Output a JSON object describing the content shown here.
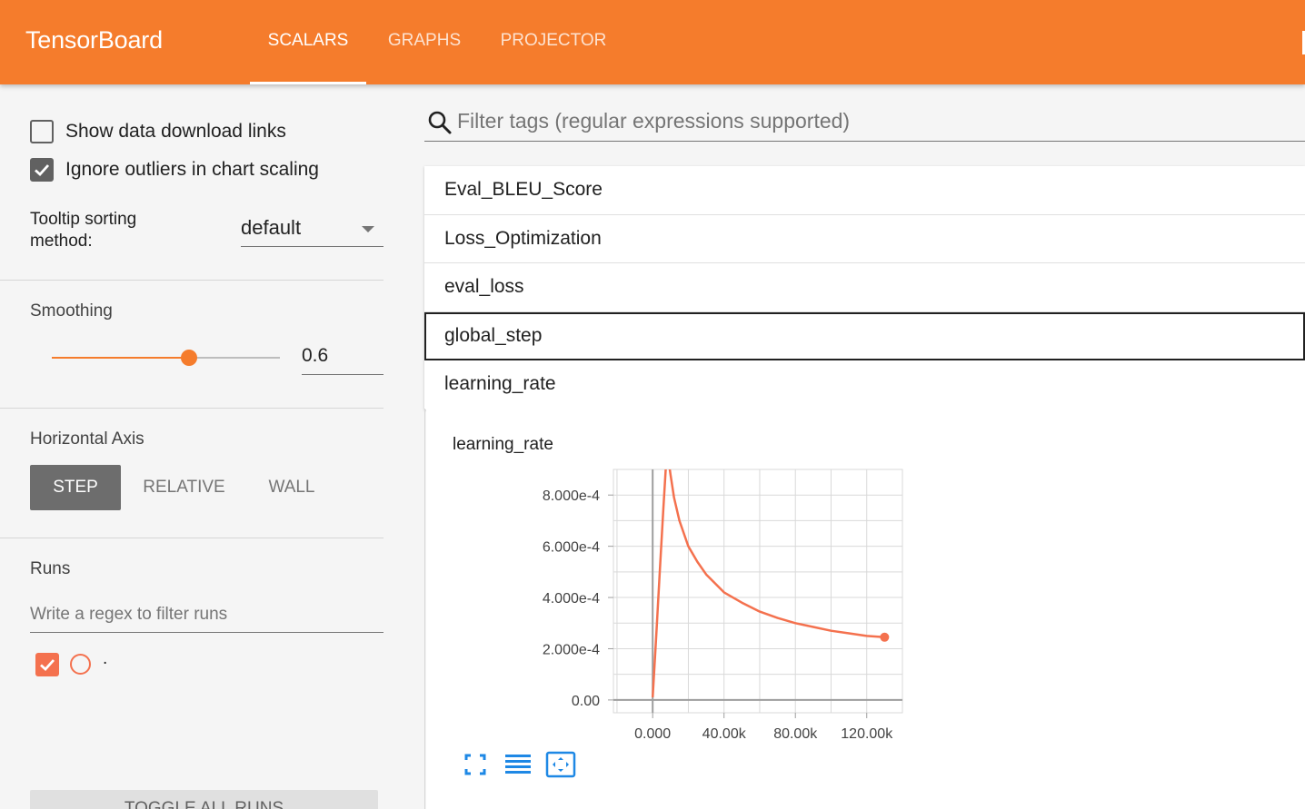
{
  "header": {
    "brand": "TensorBoard",
    "tabs": [
      {
        "label": "SCALARS",
        "active": true
      },
      {
        "label": "GRAPHS",
        "active": false
      },
      {
        "label": "PROJECTOR",
        "active": false
      }
    ],
    "background_color": "#f57c2c"
  },
  "sidebar": {
    "checkboxes": [
      {
        "label": "Show data download links",
        "checked": false
      },
      {
        "label": "Ignore outliers in chart scaling",
        "checked": true
      }
    ],
    "tooltip_sorting": {
      "label": "Tooltip sorting method:",
      "value": "default"
    },
    "smoothing": {
      "title": "Smoothing",
      "value": "0.6",
      "fraction": 0.6
    },
    "horizontal_axis": {
      "title": "Horizontal Axis",
      "options": [
        {
          "label": "STEP",
          "active": true
        },
        {
          "label": "RELATIVE",
          "active": false
        },
        {
          "label": "WALL",
          "active": false
        }
      ]
    },
    "runs": {
      "title": "Runs",
      "filter_placeholder": "Write a regex to filter runs",
      "items": [
        {
          "name": ".",
          "checked": true,
          "color": "#f4714e"
        }
      ],
      "toggle_all_label": "TOGGLE ALL RUNS"
    }
  },
  "main": {
    "search": {
      "placeholder": "Filter tags (regular expressions supported)",
      "icon": "search-icon"
    },
    "tags": [
      "Eval_BLEU_Score",
      "Loss_Optimization",
      "eval_loss",
      "global_step",
      "learning_rate"
    ],
    "focused_tag": "global_step",
    "chart_buttons": [
      "fit-to-screen-icon",
      "toggle-log-scale-icon",
      "reset-zoom-icon"
    ]
  },
  "chart_data": {
    "type": "line",
    "title": "learning_rate",
    "xlabel": "",
    "ylabel": "",
    "xlim": [
      -22000,
      140000
    ],
    "ylim": [
      -5e-05,
      0.0009
    ],
    "x_ticks": [
      0,
      40000,
      80000,
      120000
    ],
    "x_tick_labels": [
      "0.000",
      "40.00k",
      "80.00k",
      "120.00k"
    ],
    "y_ticks": [
      0,
      0.0002,
      0.0004,
      0.0006,
      0.0008
    ],
    "y_tick_labels": [
      "0.00",
      "2.000e-4",
      "4.000e-4",
      "6.000e-4",
      "8.000e-4"
    ],
    "grid": true,
    "series": [
      {
        "color": "#f4714e",
        "x": [
          0,
          2000,
          4000,
          6000,
          8000,
          10000,
          12000,
          15000,
          20000,
          25000,
          30000,
          40000,
          50000,
          60000,
          70000,
          80000,
          90000,
          100000,
          110000,
          120000,
          130000
        ],
        "y": [
          1e-05,
          0.00025,
          0.0005,
          0.00075,
          0.00098,
          0.00088,
          0.00079,
          0.0007,
          0.0006,
          0.00054,
          0.00049,
          0.00042,
          0.00038,
          0.000345,
          0.00032,
          0.0003,
          0.000285,
          0.00027,
          0.00026,
          0.00025,
          0.000245
        ]
      }
    ]
  }
}
